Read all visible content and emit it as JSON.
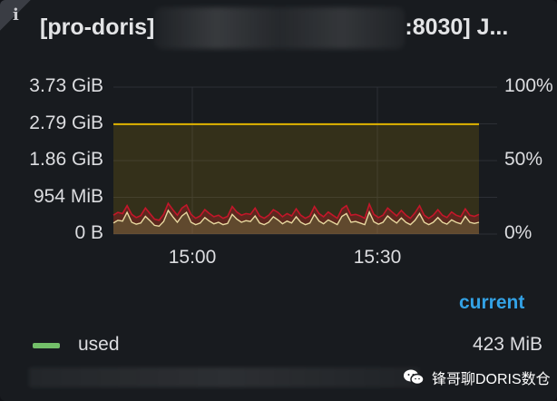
{
  "panel": {
    "info_icon": "info-icon",
    "title_prefix": "[pro-doris]",
    "title_suffix": ":8030] J...",
    "legend_header": "current",
    "watermark_text": "锋哥聊DORIS数仓",
    "watermark_icon": "wechat-icon"
  },
  "legend": [
    {
      "name": "used",
      "value": "423 MiB",
      "color": "#73bf69"
    }
  ],
  "colors": {
    "limit_line": "#e0b400",
    "used_fill": "#73bf69",
    "peak_line": "#c4162a",
    "background": "#181b1f",
    "accent": "#33a2e5"
  },
  "chart_data": {
    "type": "line",
    "y_left_ticks": [
      "3.73 GiB",
      "2.79 GiB",
      "1.86 GiB",
      "954 MiB",
      "0 B"
    ],
    "y_right_ticks": [
      "100%",
      "",
      "50%",
      "",
      "0%"
    ],
    "x_ticks": [
      "15:00",
      "15:30"
    ],
    "ylim": [
      0,
      3.73
    ],
    "grid": true,
    "legend_placement": "bottom",
    "series": [
      {
        "name": "used",
        "unit": "GiB",
        "values": [
          0.28,
          0.35,
          0.33,
          0.55,
          0.3,
          0.25,
          0.28,
          0.45,
          0.34,
          0.22,
          0.2,
          0.32,
          0.6,
          0.44,
          0.3,
          0.46,
          0.55,
          0.3,
          0.24,
          0.28,
          0.42,
          0.33,
          0.26,
          0.3,
          0.24,
          0.27,
          0.5,
          0.38,
          0.3,
          0.34,
          0.32,
          0.46,
          0.28,
          0.24,
          0.3,
          0.44,
          0.36,
          0.26,
          0.33,
          0.28,
          0.44,
          0.3,
          0.24,
          0.28,
          0.5,
          0.33,
          0.26,
          0.36,
          0.3,
          0.24,
          0.45,
          0.52,
          0.3,
          0.32,
          0.28,
          0.24,
          0.56,
          0.31,
          0.25,
          0.3,
          0.46,
          0.36,
          0.28,
          0.41,
          0.3,
          0.24,
          0.35,
          0.52,
          0.3,
          0.24,
          0.3,
          0.42,
          0.3,
          0.25,
          0.36,
          0.3,
          0.26,
          0.45,
          0.3,
          0.27,
          0.3
        ]
      },
      {
        "name": "",
        "unit": "GiB",
        "values": [
          0.48,
          0.55,
          0.52,
          0.72,
          0.5,
          0.42,
          0.47,
          0.66,
          0.52,
          0.38,
          0.35,
          0.5,
          0.78,
          0.62,
          0.48,
          0.66,
          0.74,
          0.5,
          0.4,
          0.46,
          0.62,
          0.52,
          0.44,
          0.48,
          0.4,
          0.45,
          0.7,
          0.56,
          0.48,
          0.52,
          0.5,
          0.66,
          0.46,
          0.4,
          0.48,
          0.62,
          0.55,
          0.44,
          0.52,
          0.46,
          0.64,
          0.48,
          0.4,
          0.46,
          0.7,
          0.52,
          0.44,
          0.56,
          0.48,
          0.4,
          0.64,
          0.72,
          0.48,
          0.5,
          0.46,
          0.4,
          0.76,
          0.5,
          0.42,
          0.48,
          0.66,
          0.56,
          0.46,
          0.6,
          0.48,
          0.4,
          0.54,
          0.72,
          0.48,
          0.4,
          0.48,
          0.62,
          0.48,
          0.42,
          0.56,
          0.48,
          0.44,
          0.64,
          0.48,
          0.45,
          0.5
        ]
      },
      {
        "name": "",
        "unit": "GiB",
        "values": [
          2.79,
          2.79
        ]
      }
    ]
  }
}
